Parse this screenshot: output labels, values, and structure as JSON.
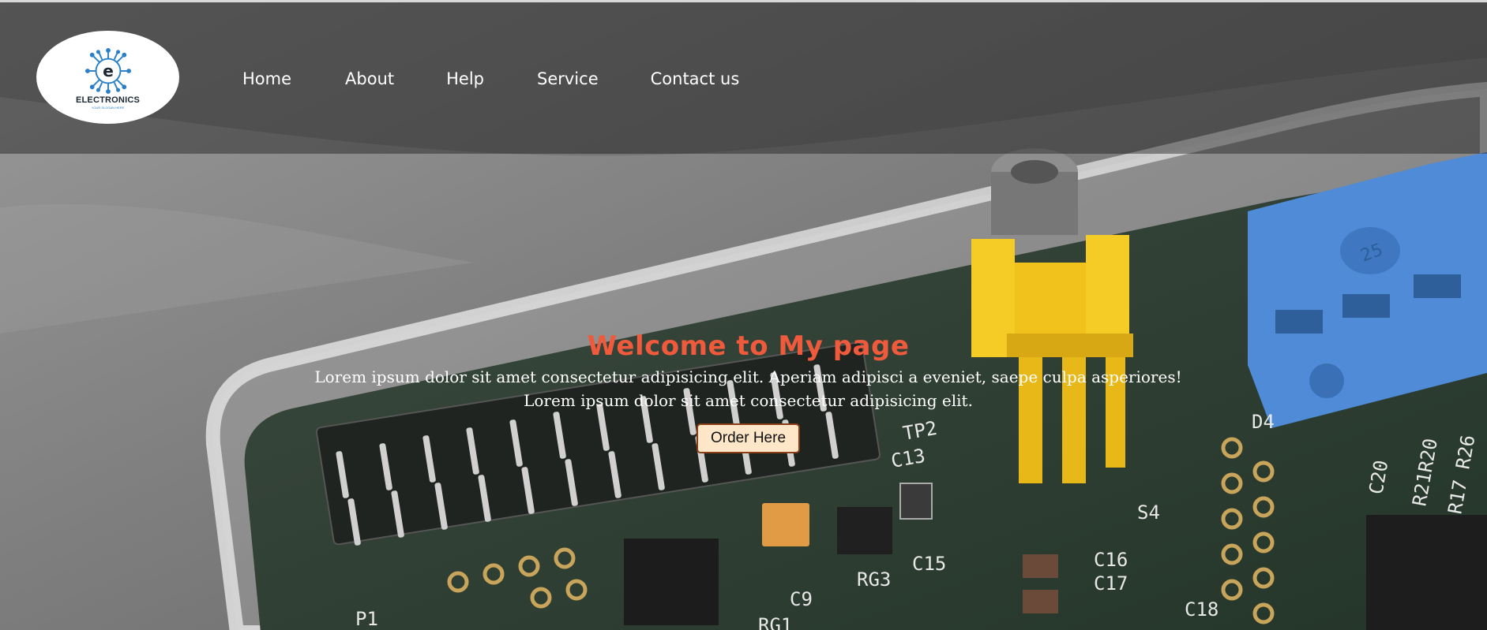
{
  "header": {
    "logo": {
      "name": "ELECTRONICS",
      "tagline": "YOUR SLOGAN HERE"
    },
    "nav": [
      {
        "label": "Home"
      },
      {
        "label": "About"
      },
      {
        "label": "Help"
      },
      {
        "label": "Service"
      },
      {
        "label": "Contact us"
      }
    ]
  },
  "hero": {
    "title": "Welcome to My page",
    "line1": "Lorem ipsum dolor sit amet consectetur adipisicing elit. Aperiam adipisci a eveniet, saepe culpa asperiores!",
    "line2": "Lorem ipsum dolor sit amet consectetur adipisicing elit.",
    "button_label": "Order Here"
  },
  "colors": {
    "title": "#f05a3c",
    "button_bg": "#fde7c8",
    "button_border": "#8a3e14",
    "logo_accent": "#2a80c8",
    "nav_text": "#ffffff"
  },
  "background": {
    "depicts": [
      "circuit-board",
      "transparent-case",
      "yellow-connector",
      "blue-terminal-block",
      "pin-header"
    ],
    "board_labels": [
      "TP2",
      "C13",
      "S4",
      "D4",
      "C20",
      "R21",
      "R20",
      "R17",
      "R26",
      "C15",
      "C16",
      "C17",
      "C18",
      "RG3",
      "C9",
      "RG1",
      "P1",
      "25"
    ]
  }
}
